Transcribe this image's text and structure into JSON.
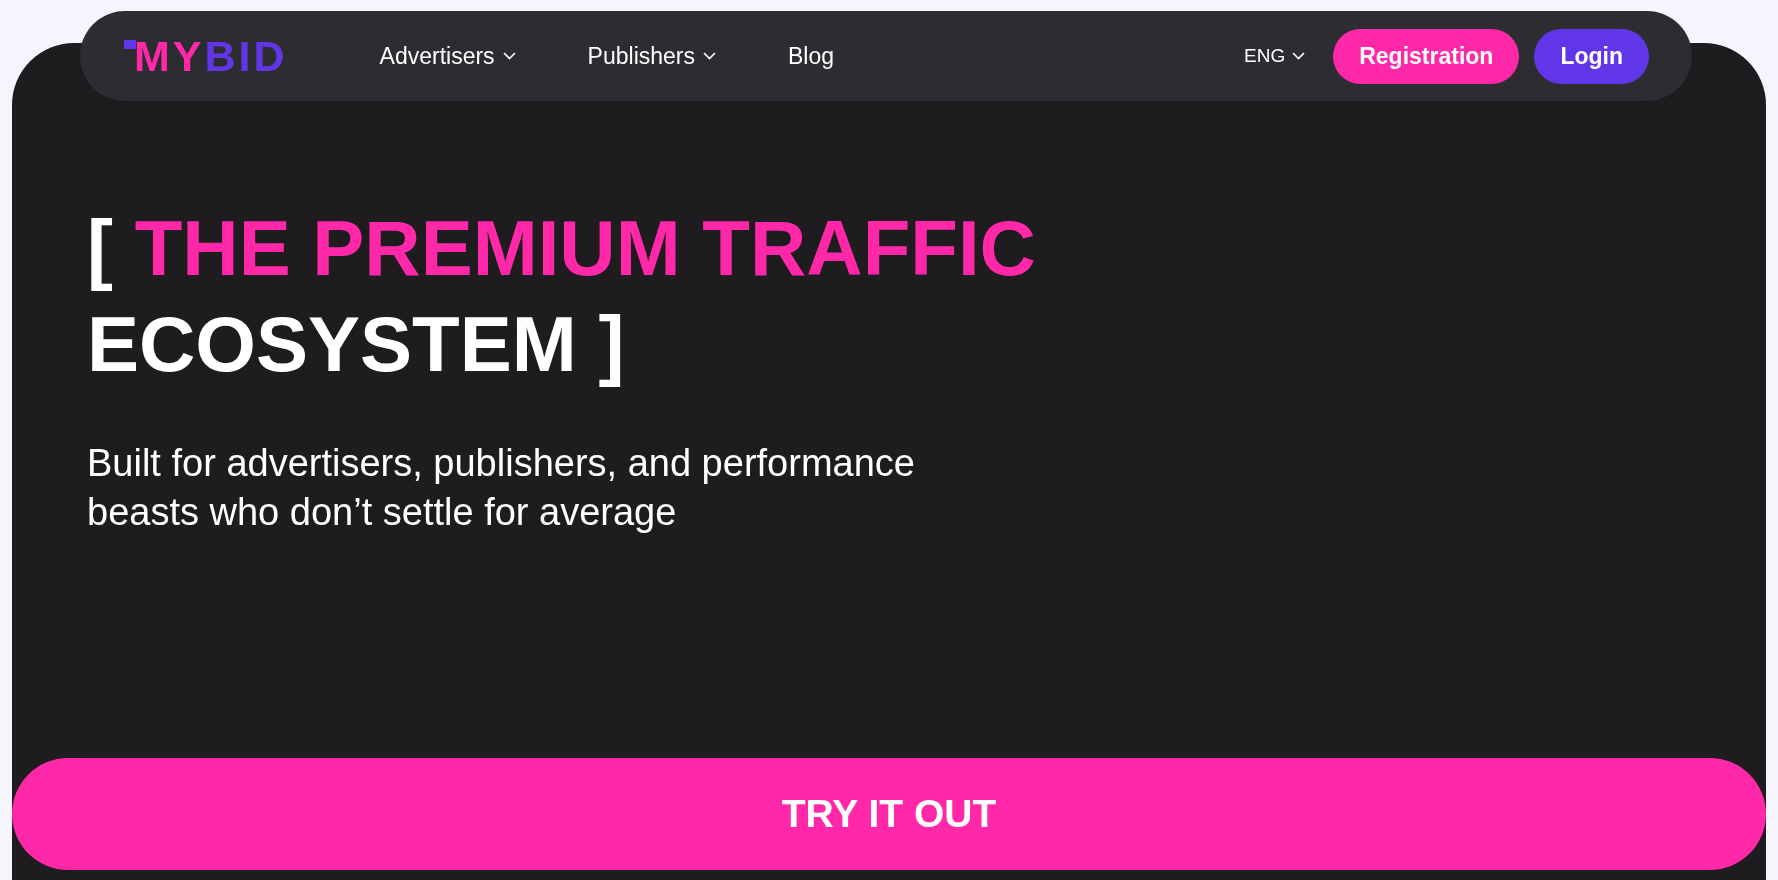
{
  "logo": {
    "segments": [
      {
        "text": "MY",
        "color": "#ff28a8"
      },
      {
        "text": "BID",
        "color": "#6036e8"
      }
    ]
  },
  "nav": {
    "items": [
      {
        "label": "Advertisers",
        "has_dropdown": true
      },
      {
        "label": "Publishers",
        "has_dropdown": true
      },
      {
        "label": "Blog",
        "has_dropdown": false
      }
    ],
    "language": {
      "label": "ENG"
    },
    "buttons": [
      {
        "label": "Registration",
        "color": "#ff28a8"
      },
      {
        "label": "Login",
        "color": "#6036e8"
      }
    ]
  },
  "hero": {
    "heading": [
      {
        "text": "[ ",
        "color": "#ffffff"
      },
      {
        "text": "THE PREMIUM TRAFFIC",
        "color": "#ff28a8"
      },
      {
        "text": " ECOSYSTEM ]",
        "color": "#ffffff"
      }
    ],
    "subheading": "Built for advertisers, publishers, and performance beasts who don’t settle for average",
    "cta": {
      "label": "TRY IT OUT"
    }
  }
}
